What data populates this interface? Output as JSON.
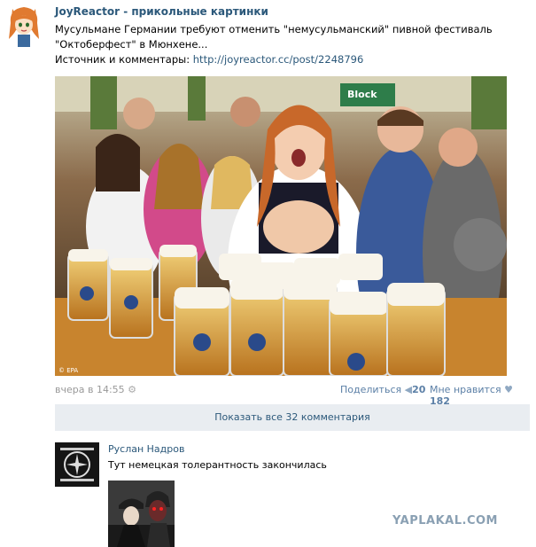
{
  "post": {
    "group_name": "JoyReactor - прикольные картинки",
    "text_line1": "Мусульмане Германии требуют отменить \"немусульманский\" пивной фестиваль \"Октоберфест\" в Мюнхене...",
    "source_label": "Источник и комментары: ",
    "source_link": "http://joyreactor.cc/post/2248796",
    "photo_credit": "© EPA",
    "photo_sign": "Block"
  },
  "meta": {
    "time": "вчера в 14:55",
    "share_label": "Поделиться",
    "share_count": "20",
    "like_label": "Мне нравится",
    "like_count": "182"
  },
  "comments": {
    "show_all": "Показать все 32 комментария",
    "author": "Руслан Надров",
    "text": "Тут немецкая толерантность закончилась"
  },
  "watermark": "YAPLAKAL.COM"
}
